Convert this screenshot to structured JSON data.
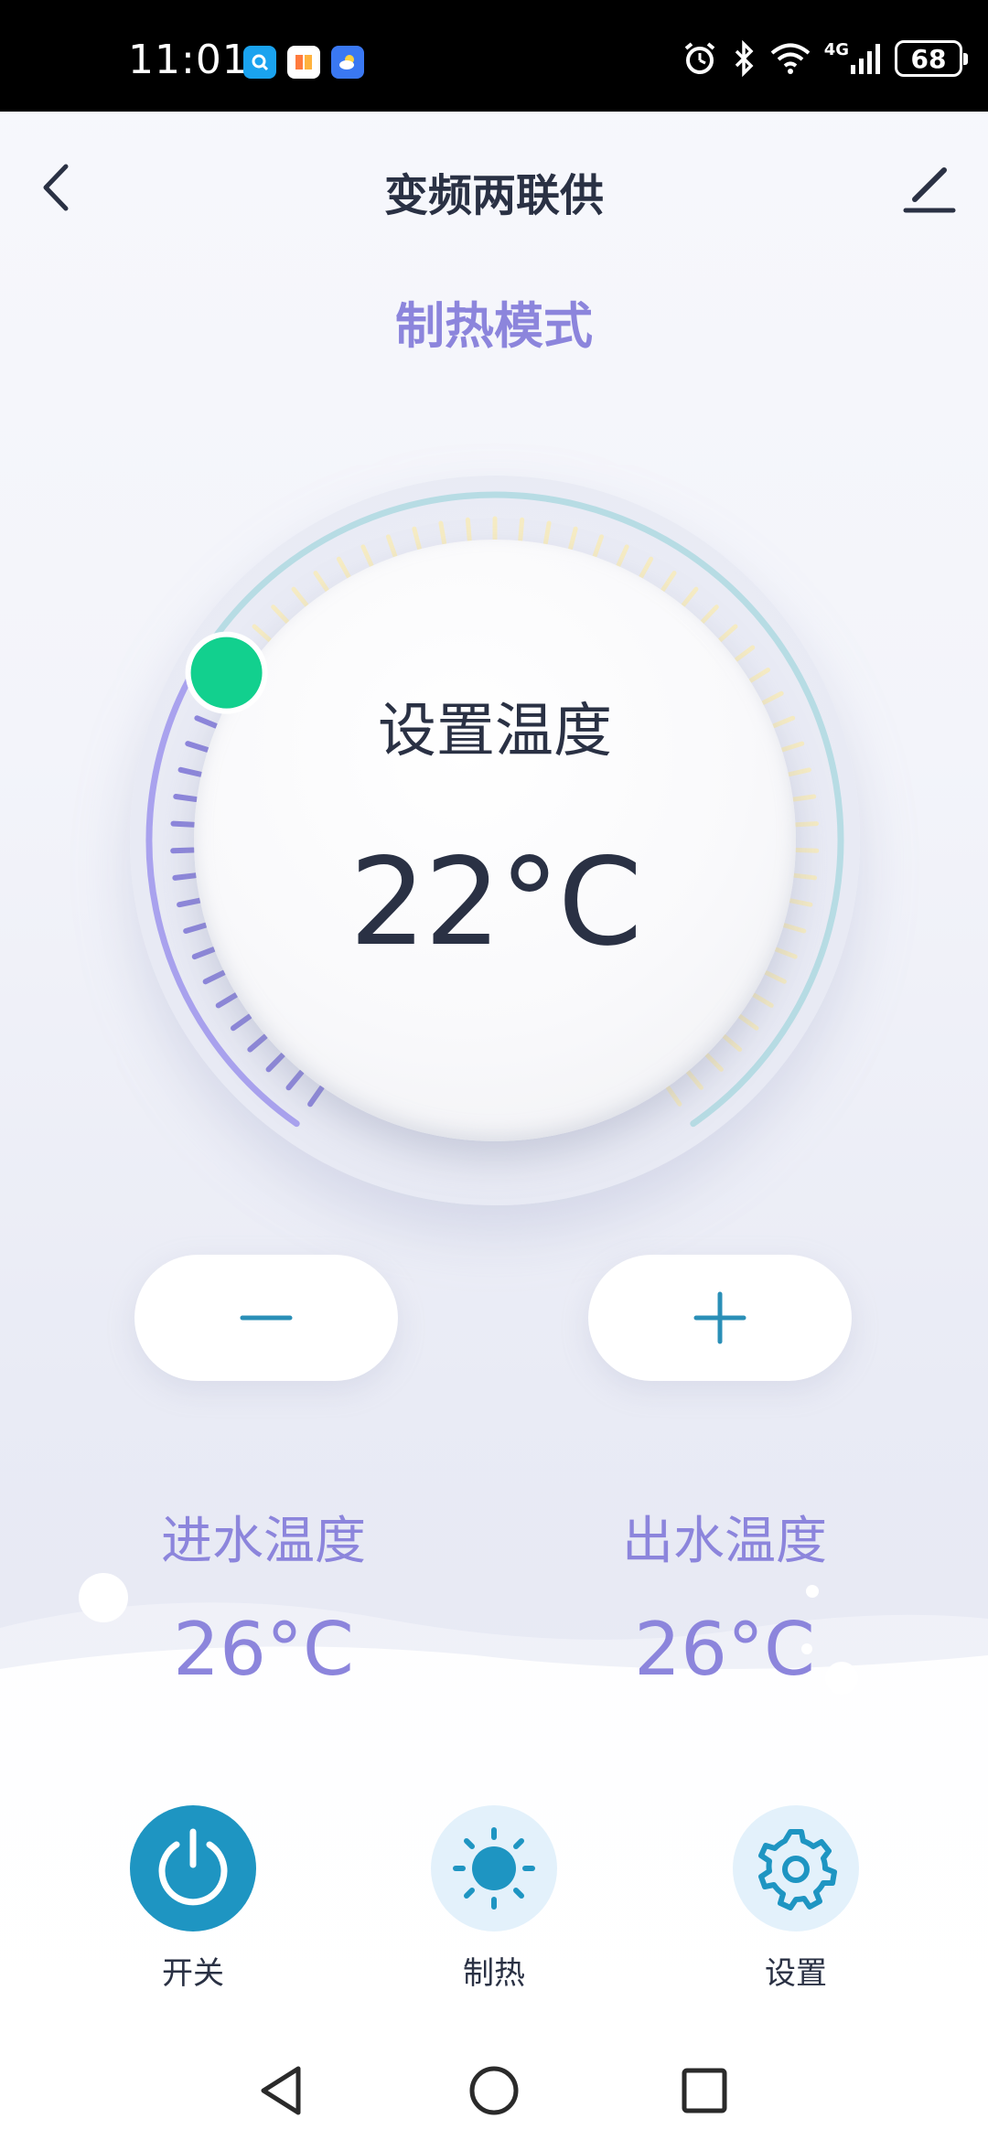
{
  "status_bar": {
    "time": "11:01",
    "battery": "68",
    "network": "4G"
  },
  "header": {
    "title": "变频两联供",
    "back_icon": "chevron-left-icon",
    "edit_icon": "pencil-icon"
  },
  "mode": "制热模式",
  "dial": {
    "label": "设置温度",
    "value": "22°C",
    "level_fraction": 0.3
  },
  "controls": {
    "minus_icon": "minus-icon",
    "plus_icon": "plus-icon"
  },
  "water": {
    "inlet_label": "进水温度",
    "inlet_value": "26°C",
    "outlet_label": "出水温度",
    "outlet_value": "26°C"
  },
  "bottom": {
    "power_label": "开关",
    "heat_label": "制热",
    "settings_label": "设置"
  },
  "colors": {
    "accent_purple": "#8c85dc",
    "power_blue": "#1e95c2",
    "knob_green": "#12d08e",
    "text_dark": "#2a3144"
  }
}
